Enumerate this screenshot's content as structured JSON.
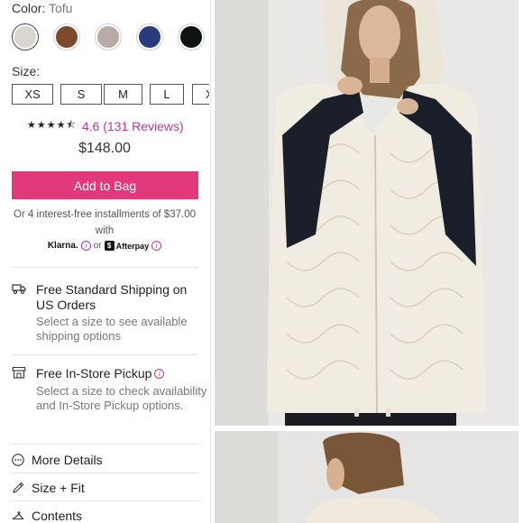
{
  "color": {
    "label": "Color:",
    "value": "Tofu"
  },
  "swatches": [
    {
      "name": "tofu",
      "color": "#d9d6d0",
      "selected": true
    },
    {
      "name": "brown",
      "color": "#7a4a2b",
      "selected": false
    },
    {
      "name": "mauve",
      "color": "#b8aaa6",
      "selected": false
    },
    {
      "name": "navy",
      "color": "#2b3a7a",
      "selected": false
    },
    {
      "name": "black",
      "color": "#0e1412",
      "selected": false
    }
  ],
  "size": {
    "label": "Size:",
    "options": [
      "XS",
      "S",
      "M",
      "L",
      "XL"
    ]
  },
  "rating": {
    "stars": "★★★★⯪",
    "text": "4.6 (131 Reviews)"
  },
  "price": "$148.00",
  "add_to_bag": "Add to Bag",
  "installments": "Or 4 interest-free installments of $37.00 with",
  "payments": {
    "klarna": "Klarna.",
    "or": "or",
    "afterpay": "Afterpay"
  },
  "shipping": {
    "title": "Free Standard Shipping on US Orders",
    "subtitle": "Select a size to see available shipping options"
  },
  "pickup": {
    "title": "Free In-Store Pickup",
    "subtitle": "Select a size to check availability and In-Store Pickup options."
  },
  "accordion": {
    "more_details": "More Details",
    "size_fit": "Size + Fit",
    "contents": "Contents"
  },
  "colors": {
    "accent": "#e2397b",
    "link": "#b23d8e"
  }
}
